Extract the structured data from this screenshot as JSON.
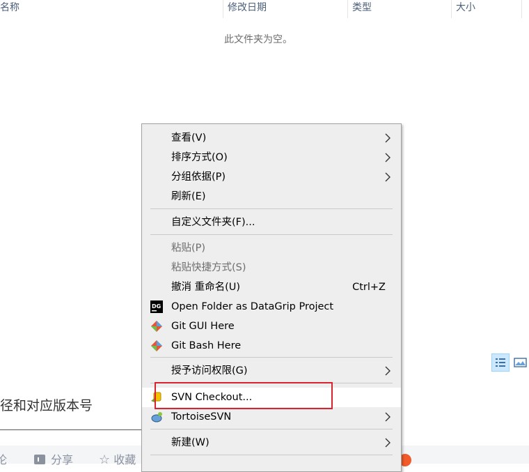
{
  "columns": {
    "name": "名称",
    "date": "修改日期",
    "type": "类型",
    "size": "大小"
  },
  "empty_message": "此文件夹为空。",
  "background": {
    "heading": "径和对应版本号",
    "footer_actions": [
      "论",
      "分享",
      "收藏"
    ]
  },
  "menu": {
    "items": [
      {
        "label": "查看(V)",
        "submenu": true
      },
      {
        "label": "排序方式(O)",
        "submenu": true
      },
      {
        "label": "分组依据(P)",
        "submenu": true
      },
      {
        "label": "刷新(E)"
      },
      {
        "label": "自定义文件夹(F)..."
      },
      {
        "label": "粘贴(P)",
        "disabled": true
      },
      {
        "label": "粘贴快捷方式(S)",
        "disabled": true
      },
      {
        "label": "撤消 重命名(U)",
        "shortcut": "Ctrl+Z"
      },
      {
        "label": "Open Folder as DataGrip Project",
        "icon": "datagrip-icon"
      },
      {
        "label": "Git GUI Here",
        "icon": "git-icon"
      },
      {
        "label": "Git Bash Here",
        "icon": "git-icon"
      },
      {
        "label": "授予访问权限(G)",
        "submenu": true
      },
      {
        "label": "SVN Checkout...",
        "icon": "svn-checkout-icon"
      },
      {
        "label": "TortoiseSVN",
        "icon": "tortoisesvn-icon",
        "submenu": true
      },
      {
        "label": "新建(W)",
        "submenu": true
      }
    ]
  },
  "colors": {
    "menu_bg": "#eeeeee",
    "highlight_border": "#d9232f",
    "header_text": "#4c607a"
  }
}
